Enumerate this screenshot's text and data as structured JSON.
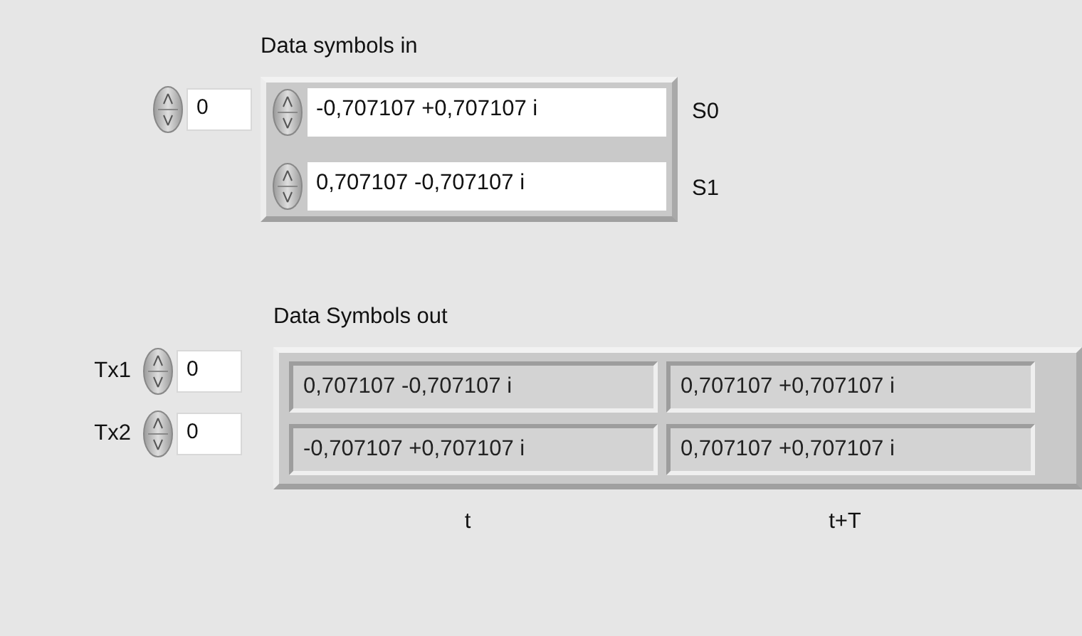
{
  "input_array": {
    "label": "Data symbols in",
    "index": "0",
    "elements": [
      {
        "value": "-0,707107 +0,707107 i",
        "tag": "S0"
      },
      {
        "value": "0,707107 -0,707107 i",
        "tag": "S1"
      }
    ]
  },
  "output_array": {
    "label": "Data Symbols out",
    "rows": [
      {
        "name": "Tx1",
        "index": "0",
        "cells": [
          "0,707107 -0,707107 i",
          "0,707107 +0,707107 i"
        ]
      },
      {
        "name": "Tx2",
        "index": "0",
        "cells": [
          "-0,707107 +0,707107 i",
          "0,707107 +0,707107 i"
        ]
      }
    ],
    "column_labels": [
      "t",
      "t+T"
    ]
  }
}
